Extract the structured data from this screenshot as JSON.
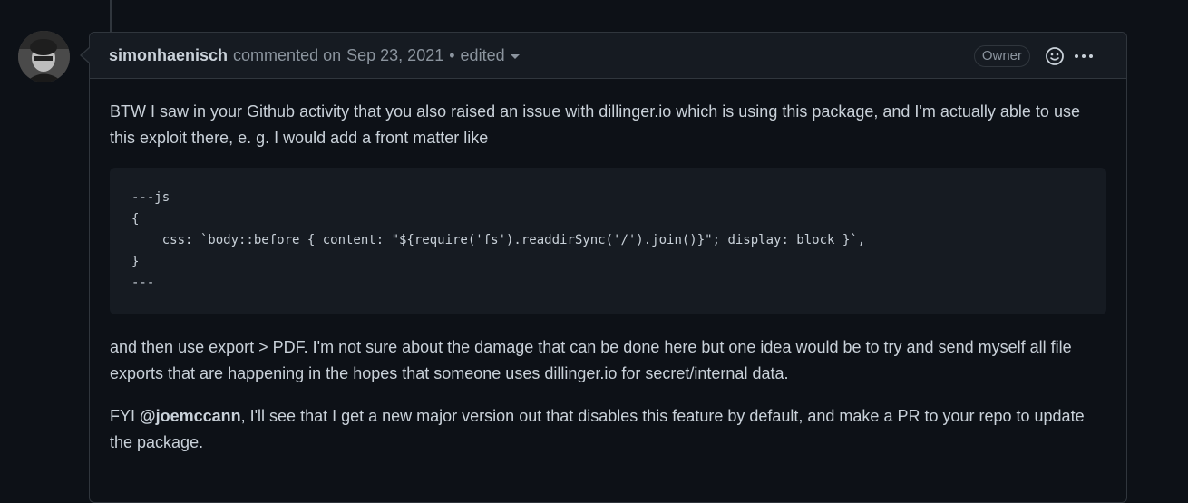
{
  "comment": {
    "author": "simonhaenisch",
    "action": "commented on",
    "date": "Sep 23, 2021",
    "separator": "•",
    "edited_label": "edited",
    "owner_badge": "Owner",
    "paragraph1": "BTW I saw in your Github activity that you also raised an issue with dillinger.io which is using this package, and I'm actually able to use this exploit there, e. g. I would add a front matter like",
    "code_lines": [
      "---js",
      "{",
      "    css: `body::before { content: \"${require('fs').readdirSync('/').join()}\"; display: block }`,",
      "}",
      "---"
    ],
    "paragraph2": "and then use export > PDF. I'm not sure about the damage that can be done here but one idea would be to try and send myself all file exports that are happening in the hopes that someone uses dillinger.io for secret/internal data.",
    "paragraph3_prefix": "FYI ",
    "paragraph3_mention": "@joemccann",
    "paragraph3_suffix": ", I'll see that I get a new major version out that disables this feature by default, and make a PR to your repo to update the package."
  },
  "icons": {
    "smiley": "smiley-icon",
    "more": "kebab-horizontal-icon",
    "caret": "triangle-down-icon"
  },
  "colors": {
    "background": "#0d1117",
    "header_bg": "#161b22",
    "border": "#30363d",
    "text": "#c9d1d9",
    "muted": "#8b949e"
  }
}
